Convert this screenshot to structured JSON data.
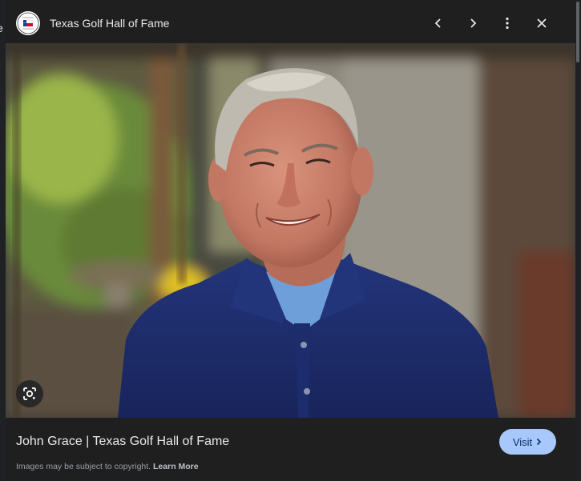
{
  "background_tab": {
    "label": "e"
  },
  "header": {
    "site_name": "Texas Golf Hall of Fame",
    "logo_icon": "texas-golf-hall-of-fame-logo-icon",
    "prev_icon": "chevron-left-icon",
    "next_icon": "chevron-right-icon",
    "more_icon": "more-vert-icon",
    "close_icon": "close-icon"
  },
  "image": {
    "subject": "portrait-photo",
    "lens_icon": "google-lens-icon"
  },
  "footer": {
    "caption": "John Grace | Texas Golf Hall of Fame",
    "visit_label": "Visit",
    "visit_icon": "chevron-right-icon",
    "copyright_text": "Images may be subject to copyright.",
    "learn_more": "Learn More"
  },
  "colors": {
    "panel_bg": "#1f1f1f",
    "visit_bg": "#a8c7fa",
    "visit_text": "#062e6f",
    "shirt": "#1f2f6e"
  }
}
